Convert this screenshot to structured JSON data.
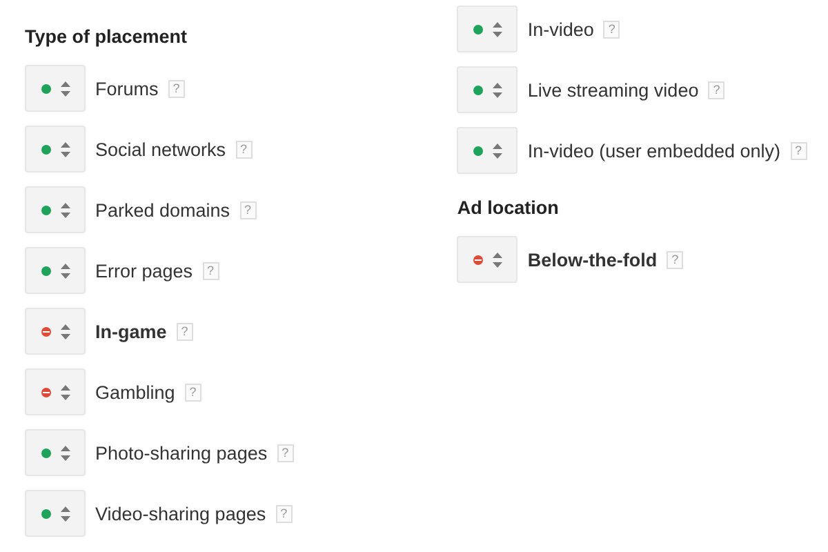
{
  "columns": [
    {
      "sections": [
        {
          "heading": "Type of placement",
          "items": [
            {
              "label": "Forums",
              "excluded": false,
              "bold": false,
              "help": "?"
            },
            {
              "label": "Social networks",
              "excluded": false,
              "bold": false,
              "help": "?"
            },
            {
              "label": "Parked domains",
              "excluded": false,
              "bold": false,
              "help": "?"
            },
            {
              "label": "Error pages",
              "excluded": false,
              "bold": false,
              "help": "?"
            },
            {
              "label": "In-game",
              "excluded": true,
              "bold": true,
              "help": "?"
            },
            {
              "label": "Gambling",
              "excluded": true,
              "bold": false,
              "help": "?"
            },
            {
              "label": "Photo-sharing pages",
              "excluded": false,
              "bold": false,
              "help": "?"
            },
            {
              "label": "Video-sharing pages",
              "excluded": false,
              "bold": false,
              "help": "?"
            }
          ]
        }
      ]
    },
    {
      "sections": [
        {
          "items": [
            {
              "label": "In-video",
              "excluded": false,
              "bold": false,
              "help": "?"
            },
            {
              "label": "Live streaming video",
              "excluded": false,
              "bold": false,
              "help": "?"
            },
            {
              "label": "In-video (user embedded only)",
              "excluded": false,
              "bold": false,
              "help": "?"
            }
          ]
        },
        {
          "heading": "Ad location",
          "items": [
            {
              "label": "Below-the-fold",
              "excluded": true,
              "bold": true,
              "help": "?"
            }
          ]
        }
      ]
    }
  ]
}
